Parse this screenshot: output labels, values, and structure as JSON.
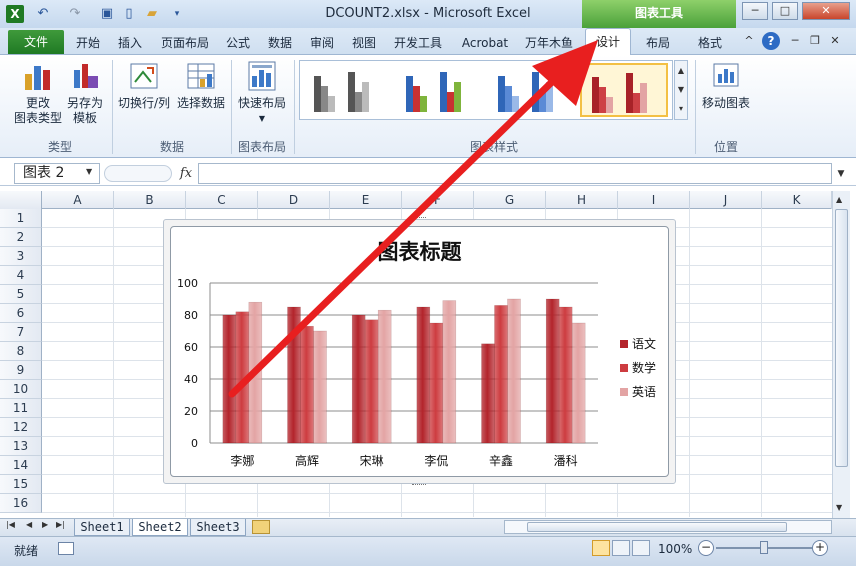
{
  "window": {
    "title": "DCOUNT2.xlsx - Microsoft Excel",
    "context_group": "图表工具",
    "minimize": "─",
    "maximize": "□",
    "close": "✕"
  },
  "tabs": {
    "file": "文件",
    "items": [
      "开始",
      "插入",
      "页面布局",
      "公式",
      "数据",
      "审阅",
      "视图",
      "开发工具",
      "Acrobat",
      "万年木鱼"
    ],
    "design": "设计",
    "layout": "布局",
    "format": "格式"
  },
  "ribbon": {
    "type_group": {
      "label": "类型",
      "change_type": "更改\n图表类型",
      "save_template": "另存为\n模板"
    },
    "data_group": {
      "label": "数据",
      "switch_row_col": "切换行/列",
      "select_data": "选择数据"
    },
    "layout_group": {
      "label": "图表布局",
      "quick_layout": "快速布局"
    },
    "styles_group": {
      "label": "图表样式"
    },
    "location_group": {
      "label": "位置",
      "move_chart": "移动图表"
    }
  },
  "formula_bar": {
    "name_box": "图表 2",
    "fx": "fx",
    "value": ""
  },
  "columns": [
    "A",
    "B",
    "C",
    "D",
    "E",
    "F",
    "G",
    "H",
    "I",
    "J",
    "K"
  ],
  "rows": [
    "1",
    "2",
    "3",
    "4",
    "5",
    "6",
    "7",
    "8",
    "9",
    "10",
    "11",
    "12",
    "13",
    "14",
    "15",
    "16"
  ],
  "sheets": [
    "Sheet1",
    "Sheet2",
    "Sheet3"
  ],
  "active_sheet": "Sheet2",
  "status": {
    "ready": "就绪",
    "zoom": "100%"
  },
  "chart_data": {
    "type": "bar",
    "title": "图表标题",
    "categories": [
      "李娜",
      "高辉",
      "宋琳",
      "李侃",
      "辛鑫",
      "潘科"
    ],
    "series": [
      {
        "name": "语文",
        "values": [
          80,
          85,
          80,
          85,
          62,
          90
        ],
        "color": "#b3242b"
      },
      {
        "name": "数学",
        "values": [
          82,
          73,
          77,
          75,
          86,
          85
        ],
        "color": "#cd3c40"
      },
      {
        "name": "英语",
        "values": [
          88,
          70,
          83,
          89,
          90,
          75
        ],
        "color": "#e3a4a4"
      }
    ],
    "ylim": [
      0,
      100
    ],
    "yticks": [
      "0",
      "20",
      "40",
      "60",
      "80",
      "100"
    ],
    "grid": true,
    "legend": "right"
  }
}
